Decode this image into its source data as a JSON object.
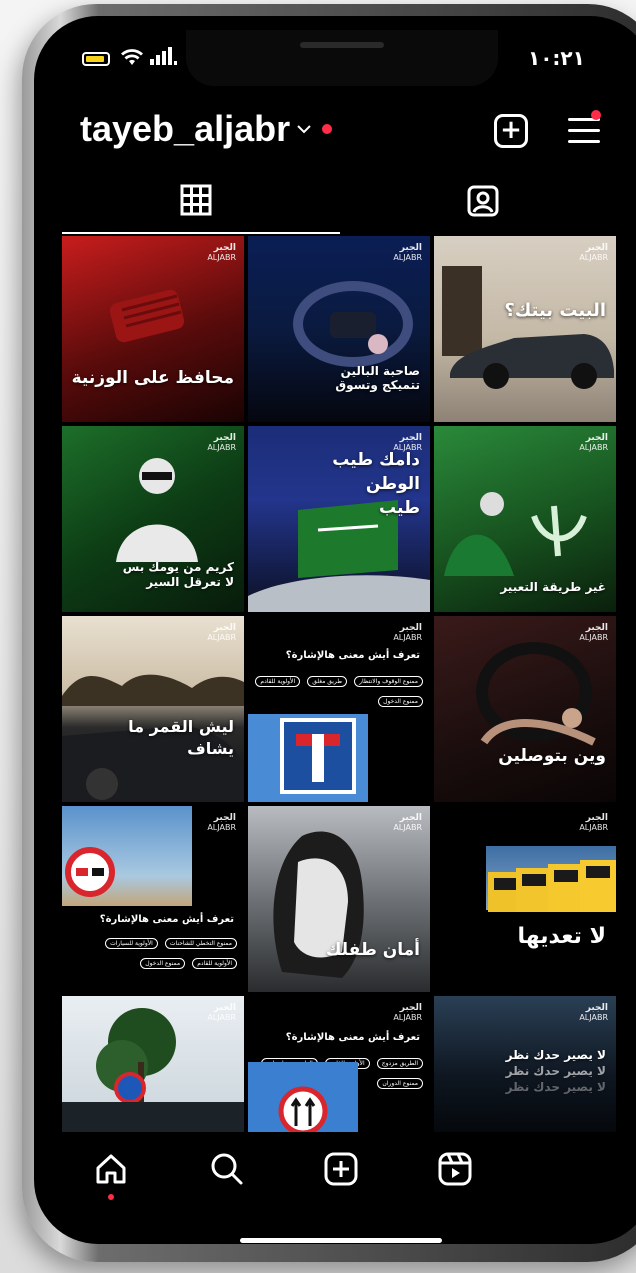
{
  "status": {
    "time": "١٠:٢١",
    "wifi": "wifi-icon",
    "signal": "signal-icon"
  },
  "profile": {
    "username": "tayeb_aljabr"
  },
  "icons": {
    "new_post": "plus-square-icon",
    "menu": "hamburger-menu-icon",
    "grid": "grid-icon",
    "tagged": "tagged-user-icon"
  },
  "colors": {
    "notification_dot": "#ff2d48",
    "background": "#000000"
  },
  "brand": {
    "logo_ar": "الجبر",
    "logo_en": "ALJABR"
  },
  "posts": [
    {
      "caption": "محافظ على الوزنية"
    },
    {
      "caption": "صاحبة البالين تتميكج وتسوق"
    },
    {
      "caption": "البيت بيتك؟"
    },
    {
      "caption": "كريم من يومك بس لا تعرقل السير"
    },
    {
      "caption": "دامك طيب الوطن طيب"
    },
    {
      "caption": "غير طريقة التعبير"
    },
    {
      "caption": "ليش القمر ما يشاف"
    },
    {
      "caption": "تعرف أيش معنى هالإشارة؟",
      "options": [
        "ممنوع الوقوف والانتظار",
        "طريق مغلق",
        "الأولوية للقادم",
        "ممنوع الدخول"
      ]
    },
    {
      "caption": "وين بتوصلين"
    },
    {
      "caption": "تعرف أيش معنى هالإشارة؟",
      "options": [
        "ممنوع التخطي للشاحنات",
        "الأولوية للسيارات",
        "الأولوية للقادم",
        "ممنوع الدخول"
      ]
    },
    {
      "caption": "أمان طفلك"
    },
    {
      "caption": "لا تعديها"
    },
    {
      "caption": ""
    },
    {
      "caption": "تعرف أيش معنى هالإشارة؟",
      "options": [
        "الطريق مزدوج",
        "الأولوية للقادم",
        "الطريق مسار واحد",
        "ممنوع الدوران"
      ]
    },
    {
      "caption": "لا يصير حدك نظر"
    }
  ],
  "bottom_nav": [
    "home-icon",
    "search-icon",
    "create-icon",
    "reels-icon"
  ]
}
